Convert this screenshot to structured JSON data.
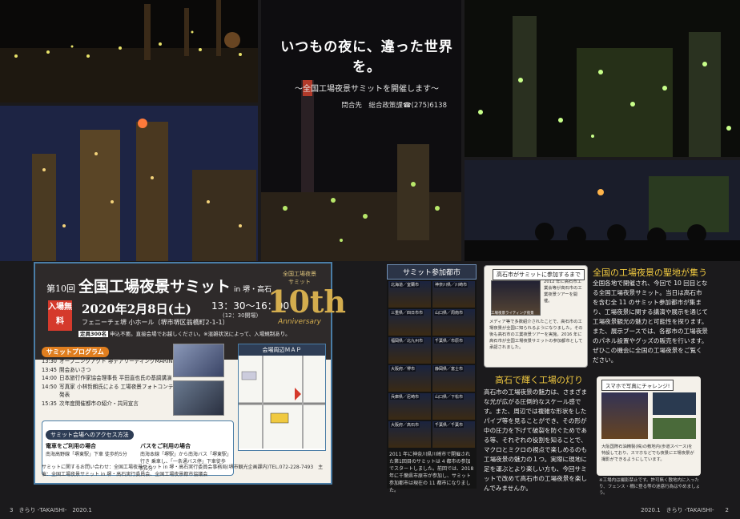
{
  "headline": {
    "title": "いつもの夜に、違った世界を。",
    "subtitle": "～全国工場夜景サミットを開催します～",
    "contact": "問合先　総合政策課☎(275)6138"
  },
  "event": {
    "edition": "第10回",
    "title": "全国工場夜景サミット",
    "title_sub": "in 堺・高石",
    "admission_badge": "入場無料",
    "date": "2020年2月8日(土)",
    "time": "13：30～16：00",
    "time_note": "(12：30開場)",
    "venue": "フェニーチェ堺 小ホール（堺市堺区翁橋町2-1-1）",
    "fee_label": "定員300名",
    "notice": "申込不要。直接会場でお越しください。※混雑状況によって、入場規制あり。",
    "anniversary": {
      "line1": "全国工場夜景",
      "line2": "サミット",
      "number": "10th",
      "label": "Anniversary"
    }
  },
  "program": {
    "heading": "サミットプログラム",
    "items": [
      {
        "time": "13:30",
        "text": "オープニングアクト 堺テアリーディングMARINE"
      },
      {
        "time": "13:45",
        "text": "開会あいさつ"
      },
      {
        "time": "14:00",
        "text": "日本旅行作家協会理事長 平田直也氏の基調講演"
      },
      {
        "time": "14:50",
        "text": "写真家 小林哲朗氏による 工場夜景フォトコンテスト入賞作品発表"
      },
      {
        "time": "15:35",
        "text": "次年度開催都市の紹介・共同宣言"
      }
    ]
  },
  "map": {
    "heading": "会場周辺ＭＡＰ"
  },
  "access": {
    "heading": "サミット会場へのアクセス方法",
    "train_title": "電車をご利用の場合",
    "train_text": "南海高野線「堺東駅」下車 徒歩約5分",
    "bus_title": "バスをご利用の場合",
    "bus_text": "南海本線「堺駅」から南海バス「堺東駅」行き 乗車し、「一条通バス停」下車徒歩約5分"
  },
  "footer_note": "サミットに関するお問い合わせ：全国工場夜景サミット in 堺・高石実行委員会事務局(堺市観光企画課内)TEL.072-228-7493　主催：全国工場夜景サミット in 堺・高石実行委員会、全国工場夜景都市協議会",
  "cities": {
    "heading": "サミット参加都市",
    "list": [
      "北海道／室蘭市",
      "神奈川県／川崎市",
      "三重県／四日市市",
      "山口県／周南市",
      "福岡県／北九州市",
      "千葉県／市原市",
      "大阪府／堺市",
      "静岡県／富士市",
      "兵庫県／尼崎市",
      "山口県／下松市",
      "大阪府／高石市",
      "千葉県／千葉市"
    ],
    "caption": "2011 年に神奈川県川崎市で開催された第1回目のサミットは 4 都市の参加でスタートしました。前回では、2018 年に千葉県市原市が参加し、サミット参加都市は現在の 11 都市になりました。"
  },
  "takaishi_box": {
    "heading": "高石市がサミットに参加するまで",
    "top_text": "2012 年に高石市工業会等が高石市の工業夜景ツアーを開催。",
    "bottom_text": "メディア等で多数紹介されたことで、高石市の工場夜景が全国に知られるようになりました。その後も高石市の工業夜景ツアーを実施。2016 年に高石市が全国工場夜景サミットの参加都市として承認されました。",
    "image_caption": "工場夜景ライティング夜景"
  },
  "section1": {
    "title": "全国の工場夜景の聖地が集う",
    "text": "全国各地で開催され、今回で 10 回目となる全国工場夜景サミット。当日は高石市を含む全 11 のサミット参加都市が集まり、工場夜景に関する講演や展示を通じて工場夜景観光の魅力と可能性を探ります。また、展示ブースでは、各都市の工場夜景のパネル設置やグッズの販売を行います。ぜひこの機会に全国の工場夜景をご覧ください。"
  },
  "section2": {
    "title": "高石で輝く工場の灯り",
    "text": "高石市の工場夜景の魅力は、さまざまな光が広がる圧倒的なスケール感です。また、周辺では複雑な形状をしたパイプ等を見ることができ、その形が中の圧力を下げて破裂を防ぐためである等、それぞれの役割を知ることで、マクロとミクロの視点で楽しめるのも工場夜景の魅力の１つ。実際に現地に足を運ぶとより楽しい方も、今回サミットで改めて高石市の工場夜景を楽しんでみませんか。"
  },
  "panel_box": {
    "title": "スマホで写真にチャレンジ!",
    "text": "大阪国際石油精製(株)の敷地内(歩道スペース)を特設しており、スマホなどでも夜景に工場夜景が撮影ができるようにしています。"
  },
  "panel_caption": "※工場内は撮影禁止です。許可無く敷地内に入ったり、フェンス・柵に登る等の迷惑行為はやめましょう。",
  "page_left": "3　きらり -TAKAISHI-　2020.1",
  "page_right": "2020.1　きらり -TAKAISHI-　　2"
}
